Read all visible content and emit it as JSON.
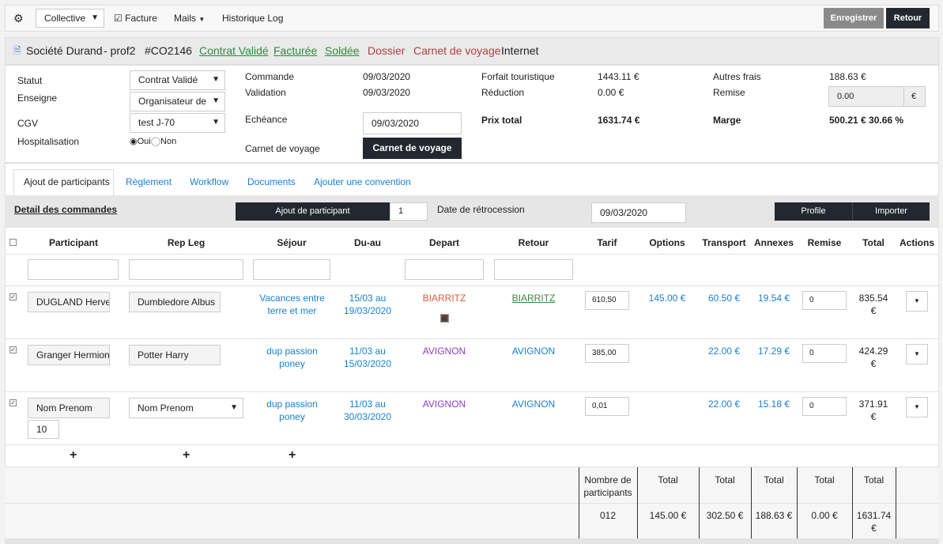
{
  "toolbar": {
    "mode_select": "Collective",
    "facture_label": "Facture",
    "mails_label": "Mails",
    "historique_label": "Historique Log",
    "save_label": "Enregistrer",
    "back_label": "Retour"
  },
  "header": {
    "company": "Société Durand",
    "prof": "- prof2",
    "code": "#CO2146",
    "status_contrat": "Contrat Validé",
    "status_facturee": "Facturée",
    "status_soldee": "Soldée",
    "status_dossier": "Dossier",
    "status_carnet": "Carnet de voyage",
    "status_internet": "Internet"
  },
  "info": {
    "statut_label": "Statut",
    "statut_value": "Contrat Validé",
    "enseigne_label": "Enseigne",
    "enseigne_value": "Organisateur de",
    "cgv_label": "CGV",
    "cgv_value": "test J-70",
    "hospitalisation_label": "Hospitalisation",
    "oui": "Oui",
    "non": "Non",
    "commande_label": "Commande",
    "commande_value": "09/03/2020",
    "validation_label": "Validation",
    "validation_value": "09/03/2020",
    "echeance_label": "Echéance",
    "echeance_value": "09/03/2020",
    "carnet_label": "Carnet de voyage",
    "carnet_button": "Carnet de voyage",
    "forfait_label": "Forfait touristique",
    "forfait_value": "1443.11 €",
    "reduction_label": "Réduction",
    "reduction_value": "0.00 €",
    "prix_total_label": "Prix total",
    "prix_total_value": "1631.74 €",
    "autres_label": "Autres frais",
    "autres_value": "188.63 €",
    "remise_label": "Remise",
    "remise_value": "0.00",
    "remise_unit": "€",
    "marge_label": "Marge",
    "marge_value": "500.21 € 30.66 %"
  },
  "tabs": [
    "Ajout de participants",
    "Règlement",
    "Workflow",
    "Documents",
    "Ajouter une convention"
  ],
  "participants_bar": {
    "detail_link": "Detail des commandes",
    "add_button": "Ajout de participant",
    "add_count": "1",
    "retro_label": "Date de rétrocession",
    "retro_value": "09/03/2020",
    "profile_button": "Profile",
    "import_button": "Importer"
  },
  "columns": [
    "Participant",
    "Rep Leg",
    "Séjour",
    "Du-au",
    "Depart",
    "Retour",
    "Tarif",
    "Options",
    "Transport",
    "Annexes",
    "Remise",
    "Total",
    "Actions"
  ],
  "rows": [
    {
      "participant": "DUGLAND Herve",
      "rep_leg": "Dumbledore Albus",
      "sejour": "Vacances entre terre et mer",
      "du_au": "15/03 au 19/03/2020",
      "depart": "BIARRITZ",
      "retour": "BIARRITZ",
      "tarif": "610,50",
      "options": "145.00 €",
      "transport": "60.50 €",
      "annexes": "19.54 €",
      "remise": "0",
      "total": "835.54 €"
    },
    {
      "participant": "Granger Hermione",
      "rep_leg": "Potter Harry",
      "sejour": "dup passion poney",
      "du_au": "11/03 au 15/03/2020",
      "depart": "AVIGNON",
      "retour": "AVIGNON",
      "tarif": "385,00",
      "options": "",
      "transport": "22.00 €",
      "annexes": "17.29 €",
      "remise": "0",
      "total": "424.29 €"
    },
    {
      "participant": "Nom Prenom",
      "rep_leg": "Nom Prenom",
      "sejour": "dup passion poney",
      "du_au": "11/03 au 30/03/2020",
      "depart": "AVIGNON",
      "retour": "AVIGNON",
      "tarif": "0,01",
      "options": "",
      "transport": "22.00 €",
      "annexes": "15.18 €",
      "remise": "0",
      "total": "371.91 €",
      "extra": "10"
    }
  ],
  "summary": {
    "headers": [
      "Nombre de participants",
      "Total",
      "Total",
      "Total",
      "Total",
      "Total"
    ],
    "values": [
      "012",
      "145.00 €",
      "302.50 €",
      "188.63 €",
      "0.00 €",
      "1631.74 €"
    ]
  },
  "colors": {
    "dark_button": "#23272f",
    "link_blue": "#1a80d0",
    "green": "#2e8b3d",
    "red": "#b14040",
    "purple": "#8e3dbf",
    "orange": "#e05a3a"
  }
}
